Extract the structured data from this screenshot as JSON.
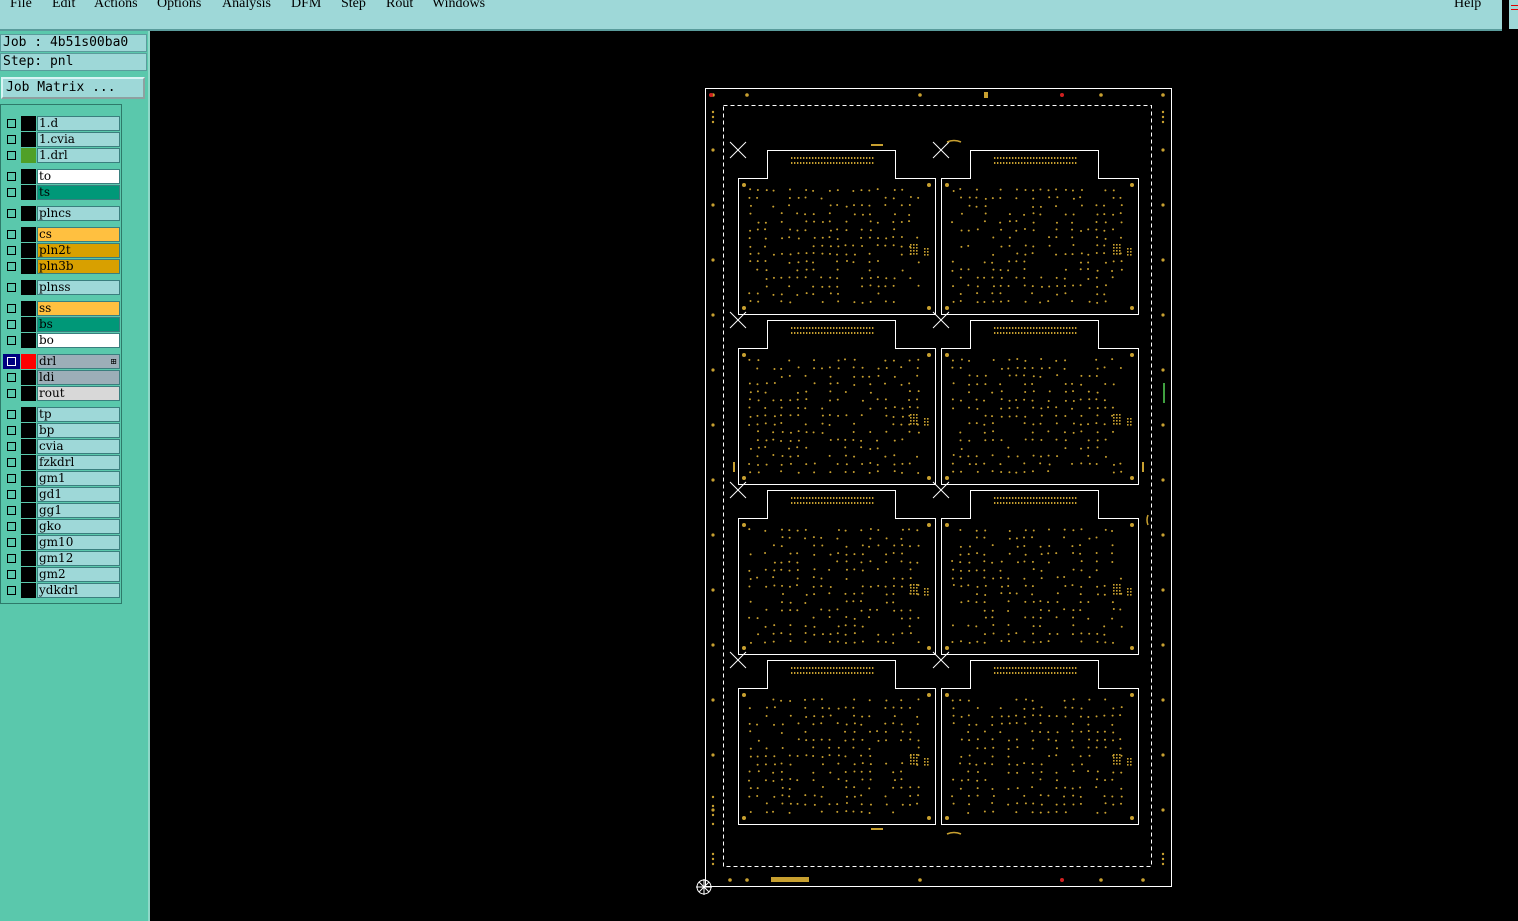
{
  "menubar": {
    "items": [
      "File",
      "Edit",
      "Actions",
      "Options",
      "Analysis",
      "DFM",
      "Step",
      "Rout",
      "Windows"
    ],
    "help": "Help"
  },
  "job": {
    "line": "Job : 4b51s00ba0"
  },
  "step": {
    "line": "Step: pnl"
  },
  "job_matrix_button": "Job Matrix ...",
  "layers": [
    {
      "name": "1.d",
      "bg": "#9ed8d8",
      "swatch": "#000000"
    },
    {
      "name": "1.cvia",
      "bg": "#9ed8d8",
      "swatch": "#000000"
    },
    {
      "name": "1.drl",
      "bg": "#9ed8d8",
      "swatch": "#50a028"
    },
    {
      "name": "to",
      "bg": "#ffffff",
      "swatch": "#000000"
    },
    {
      "name": "ts",
      "bg": "#009878",
      "swatch": "#000000"
    },
    {
      "name": "plncs",
      "bg": "#9ed8d8",
      "swatch": "#000000"
    },
    {
      "name": "cs",
      "bg": "#ffc040",
      "swatch": "#000000"
    },
    {
      "name": "pln2t",
      "bg": "#d8a000",
      "swatch": "#000000"
    },
    {
      "name": "pln3b",
      "bg": "#d8a000",
      "swatch": "#000000"
    },
    {
      "name": "plnss",
      "bg": "#9ed8d8",
      "swatch": "#000000"
    },
    {
      "name": "ss",
      "bg": "#ffc040",
      "swatch": "#000000"
    },
    {
      "name": "bs",
      "bg": "#009878",
      "swatch": "#000000"
    },
    {
      "name": "bo",
      "bg": "#ffffff",
      "swatch": "#000000"
    },
    {
      "name": "drl",
      "bg": "#9caeb8",
      "swatch": "#ff0000",
      "active": true,
      "marker": "⊞"
    },
    {
      "name": "ldi",
      "bg": "#9caeb8",
      "swatch": "#000000"
    },
    {
      "name": "rout",
      "bg": "#d8d8d8",
      "swatch": "#000000"
    },
    {
      "name": "tp",
      "bg": "#9ed8d8",
      "swatch": "#000000"
    },
    {
      "name": "bp",
      "bg": "#9ed8d8",
      "swatch": "#000000"
    },
    {
      "name": "cvia",
      "bg": "#9ed8d8",
      "swatch": "#000000"
    },
    {
      "name": "fzkdrl",
      "bg": "#9ed8d8",
      "swatch": "#000000"
    },
    {
      "name": "gm1",
      "bg": "#9ed8d8",
      "swatch": "#000000"
    },
    {
      "name": "gd1",
      "bg": "#9ed8d8",
      "swatch": "#000000"
    },
    {
      "name": "gg1",
      "bg": "#9ed8d8",
      "swatch": "#000000"
    },
    {
      "name": "gko",
      "bg": "#9ed8d8",
      "swatch": "#000000"
    },
    {
      "name": "gm10",
      "bg": "#9ed8d8",
      "swatch": "#000000"
    },
    {
      "name": "gm12",
      "bg": "#9ed8d8",
      "swatch": "#000000"
    },
    {
      "name": "gm2",
      "bg": "#9ed8d8",
      "swatch": "#000000"
    },
    {
      "name": "ydkdrl",
      "bg": "#9ed8d8",
      "swatch": "#000000"
    }
  ],
  "panel": {
    "boards": {
      "cols": 2,
      "rows": 4
    },
    "colors": {
      "outline": "#ffffff",
      "pad": "#c8a030",
      "fiducial": "#d02020",
      "marker": "#40a040"
    }
  }
}
